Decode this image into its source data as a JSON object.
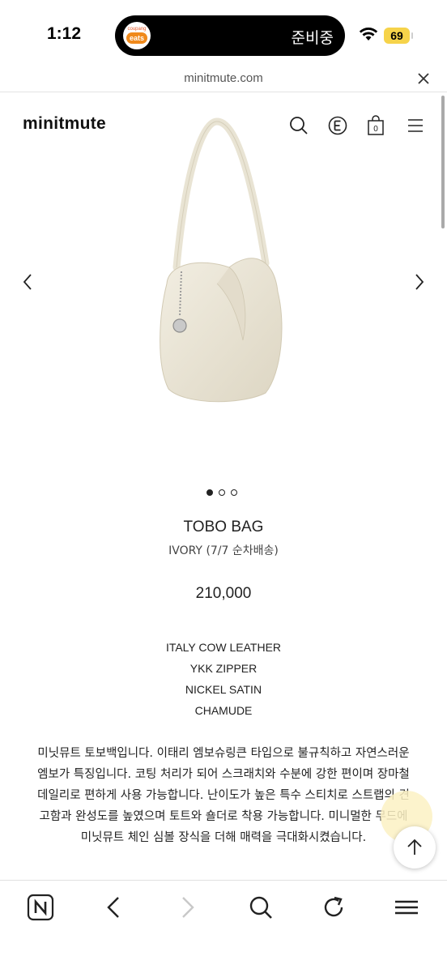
{
  "status_bar": {
    "time": "1:12",
    "island_app_line1": "coupang",
    "island_app_line2": "eats",
    "island_status": "준비중",
    "battery": "69"
  },
  "browser": {
    "url": "minitmute.com"
  },
  "header": {
    "brand": "minitmute",
    "icons": [
      "search-icon",
      "e-logo-icon",
      "shopping-bag-icon",
      "menu-icon"
    ],
    "cart_count": "0"
  },
  "gallery": {
    "total_images": 3,
    "active_index": 0
  },
  "product": {
    "name": "TOBO BAG",
    "variant": "IVORY (7/7 순차배송)",
    "price": "210,000",
    "specs": [
      "ITALY COW LEATHER",
      "YKK ZIPPER",
      "NICKEL SATIN",
      "CHAMUDE"
    ],
    "description": "미닛뮤트 토보백입니다. 이태리 엠보슈링큰 타입으로 불규칙하고 자연스러운 엠보가 특징입니다. 코팅 처리가 되어 스크래치와 수분에 강한 편이며 장마철 데일리로 편하게 사용 가능합니다. 난이도가 높은 특수 스티치로 스트랩의 견고함과 완성도를 높였으며 토트와 숄더로 착용 가능합니다. 미니멀한 무드에 미닛뮤트 체인 심볼 장식을 더해 매력을 극대화시켰습니다."
  },
  "colors": {
    "bag_body": "#ede8d9",
    "bag_shadow": "#d9d2bd",
    "text": "#222222",
    "battery": "#f6d34a"
  },
  "toolbar": {
    "icons": [
      "naver-n-icon",
      "back-arrow-icon",
      "forward-arrow-icon",
      "search-icon",
      "reload-icon",
      "menu-icon"
    ]
  }
}
